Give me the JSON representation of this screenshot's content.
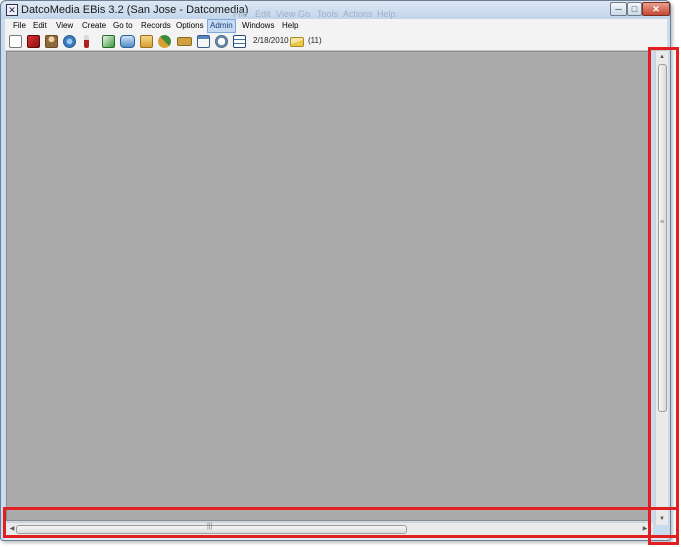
{
  "window": {
    "title": "DatcoMedia EBis 3.2 (San Jose - Datcomedia)",
    "background_menu_ghost": [
      "File",
      "Edit",
      "View",
      "Go",
      "Tools",
      "Actions",
      "Help"
    ],
    "controls": {
      "minimize": "─",
      "maximize": "□",
      "close": "✕"
    }
  },
  "menubar": {
    "items": [
      {
        "label": "File"
      },
      {
        "label": "Edit"
      },
      {
        "label": "View"
      },
      {
        "label": "Create"
      },
      {
        "label": "Go to"
      },
      {
        "label": "Records"
      },
      {
        "label": "Options"
      },
      {
        "label": "Admin",
        "active": true
      },
      {
        "label": "Windows"
      },
      {
        "label": "Help"
      }
    ]
  },
  "toolbar": {
    "icons": [
      {
        "name": "blank-page-icon",
        "color": "#ffffff"
      },
      {
        "name": "red-book-icon",
        "color": "#c01818"
      },
      {
        "name": "person-icon",
        "color": "#8a6a3a"
      },
      {
        "name": "globe-gear-icon",
        "color": "#3a7ac0"
      },
      {
        "name": "brush-icon",
        "color": "#b02020"
      },
      {
        "name": "green-document-icon",
        "color": "#3c9a3c"
      },
      {
        "name": "cards-icon",
        "color": "#4e8ec8"
      },
      {
        "name": "folder-user-icon",
        "color": "#d8a030"
      },
      {
        "name": "exchange-arrows-icon",
        "color": "#3c8a3c"
      },
      {
        "name": "tickets-icon",
        "color": "#d0a040"
      },
      {
        "name": "calendar-icon",
        "color": "#5a86c0"
      },
      {
        "name": "stopwatch-icon",
        "color": "#6a8aa8"
      },
      {
        "name": "grid-table-icon",
        "color": "#4470a8"
      }
    ],
    "date": "2/18/2010",
    "mail_icon": {
      "name": "envelope-icon",
      "color": "#e8c84a"
    },
    "mail_count": "(11)"
  },
  "colors": {
    "client_background": "#ababab",
    "highlight": "#e02020",
    "active_menu": "#c7dcf4"
  },
  "scrollbars": {
    "vertical_grip": "≡",
    "horizontal_grip": "|||",
    "arrow_up": "▲",
    "arrow_down": "▼",
    "arrow_left": "◀",
    "arrow_right": "▶"
  }
}
